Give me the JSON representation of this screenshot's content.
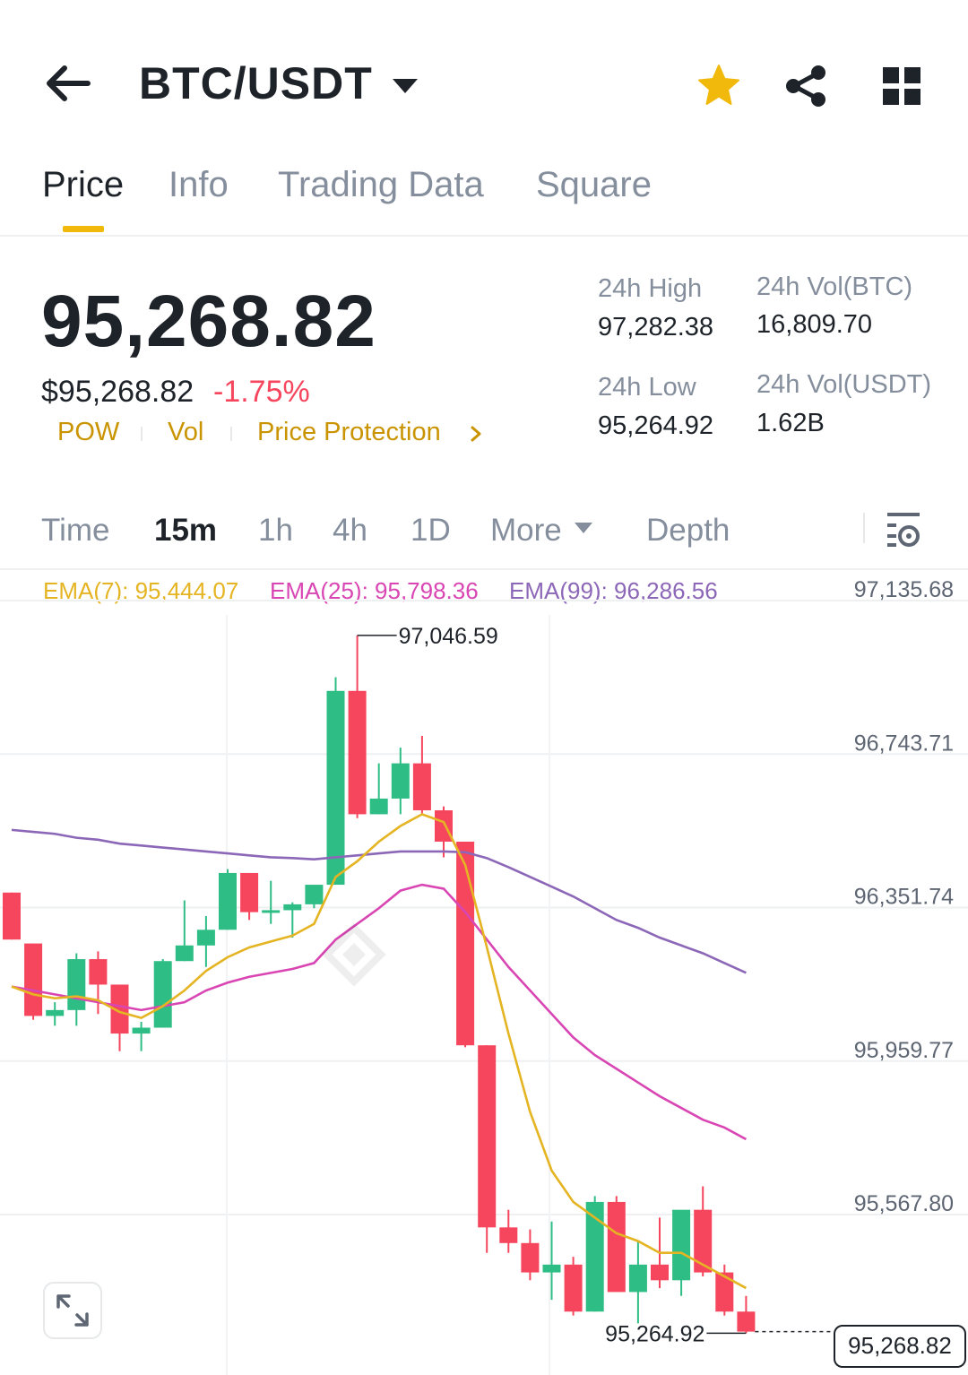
{
  "header": {
    "pair": "BTC/USDT",
    "icons": {
      "back": "back-arrow-icon",
      "caret": "caret-down-icon",
      "favorite": "star-icon",
      "share": "share-icon",
      "layout": "grid-icon"
    },
    "favorite_color": "#f0b90b"
  },
  "tabs": [
    {
      "label": "Price",
      "active": true
    },
    {
      "label": "Info",
      "active": false
    },
    {
      "label": "Trading Data",
      "active": false
    },
    {
      "label": "Square",
      "active": false
    }
  ],
  "price": {
    "last": "95,268.82",
    "fiat": "$95,268.82",
    "change": "-1.75%",
    "change_color": "#f6465d",
    "tags": [
      "POW",
      "Vol",
      "Price Protection"
    ]
  },
  "stats": {
    "high_label": "24h High",
    "high_value": "97,282.38",
    "low_label": "24h Low",
    "low_value": "95,264.92",
    "vol_btc_label": "24h Vol(BTC)",
    "vol_btc_value": "16,809.70",
    "vol_usdt_label": "24h Vol(USDT)",
    "vol_usdt_value": "1.62B"
  },
  "intervals": [
    {
      "label": "Time",
      "active": false
    },
    {
      "label": "15m",
      "active": true
    },
    {
      "label": "1h",
      "active": false
    },
    {
      "label": "4h",
      "active": false
    },
    {
      "label": "1D",
      "active": false
    },
    {
      "label": "More",
      "active": false
    },
    {
      "label": "Depth",
      "active": false
    }
  ],
  "ema": {
    "ema7": "EMA(7): 95,444.07",
    "ema25": "EMA(25): 95,798.36",
    "ema99": "EMA(99): 96,286.56",
    "ema7_color": "#e5b422",
    "ema25_color": "#d946b4",
    "ema99_color": "#8c67b8"
  },
  "chart_data": {
    "type": "candlestick",
    "up_color": "#2ebd85",
    "down_color": "#f6465d",
    "y_ticks": [
      "97,135.68",
      "96,743.71",
      "96,351.74",
      "95,959.77",
      "95,567.80"
    ],
    "ylim": [
      95150,
      97250
    ],
    "high_marker": "97,046.59",
    "low_marker": "95,264.92",
    "last_price": "95,268.82",
    "candles": [
      {
        "o": 96390,
        "h": 96390,
        "l": 96270,
        "c": 96270
      },
      {
        "o": 96260,
        "h": 96260,
        "l": 96065,
        "c": 96075
      },
      {
        "o": 96075,
        "h": 96110,
        "l": 96050,
        "c": 96090
      },
      {
        "o": 96090,
        "h": 96235,
        "l": 96050,
        "c": 96220
      },
      {
        "o": 96220,
        "h": 96240,
        "l": 96080,
        "c": 96155
      },
      {
        "o": 96155,
        "h": 96155,
        "l": 95985,
        "c": 96030
      },
      {
        "o": 96030,
        "h": 96060,
        "l": 95985,
        "c": 96045
      },
      {
        "o": 96045,
        "h": 96220,
        "l": 96045,
        "c": 96215
      },
      {
        "o": 96215,
        "h": 96370,
        "l": 96215,
        "c": 96255
      },
      {
        "o": 96255,
        "h": 96330,
        "l": 96200,
        "c": 96295
      },
      {
        "o": 96295,
        "h": 96450,
        "l": 96295,
        "c": 96440
      },
      {
        "o": 96440,
        "h": 96440,
        "l": 96320,
        "c": 96340
      },
      {
        "o": 96340,
        "h": 96420,
        "l": 96310,
        "c": 96345
      },
      {
        "o": 96345,
        "h": 96365,
        "l": 96275,
        "c": 96360
      },
      {
        "o": 96360,
        "h": 96365,
        "l": 96350,
        "c": 96410
      },
      {
        "o": 96410,
        "h": 96940,
        "l": 96410,
        "c": 96905
      },
      {
        "o": 96905,
        "h": 97046.59,
        "l": 96580,
        "c": 96590
      },
      {
        "o": 96590,
        "h": 96720,
        "l": 96590,
        "c": 96630
      },
      {
        "o": 96630,
        "h": 96760,
        "l": 96590,
        "c": 96720
      },
      {
        "o": 96720,
        "h": 96790,
        "l": 96590,
        "c": 96600
      },
      {
        "o": 96600,
        "h": 96610,
        "l": 96480,
        "c": 96520
      },
      {
        "o": 96520,
        "h": 96520,
        "l": 95995,
        "c": 96000
      },
      {
        "o": 96000,
        "h": 96000,
        "l": 95470,
        "c": 95535
      },
      {
        "o": 95535,
        "h": 95580,
        "l": 95470,
        "c": 95495
      },
      {
        "o": 95495,
        "h": 95530,
        "l": 95400,
        "c": 95420
      },
      {
        "o": 95420,
        "h": 95550,
        "l": 95350,
        "c": 95440
      },
      {
        "o": 95440,
        "h": 95460,
        "l": 95310,
        "c": 95320
      },
      {
        "o": 95320,
        "h": 95615,
        "l": 95320,
        "c": 95600
      },
      {
        "o": 95600,
        "h": 95615,
        "l": 95370,
        "c": 95370
      },
      {
        "o": 95370,
        "h": 95500,
        "l": 95290,
        "c": 95440
      },
      {
        "o": 95440,
        "h": 95560,
        "l": 95380,
        "c": 95400
      },
      {
        "o": 95400,
        "h": 95575,
        "l": 95360,
        "c": 95580
      },
      {
        "o": 95580,
        "h": 95640,
        "l": 95410,
        "c": 95420
      },
      {
        "o": 95420,
        "h": 95440,
        "l": 95310,
        "c": 95320
      },
      {
        "o": 95320,
        "h": 95360,
        "l": 95264.92,
        "c": 95268.82
      }
    ],
    "ema7_series": [
      96150,
      96130,
      96120,
      96125,
      96115,
      96085,
      96070,
      96100,
      96140,
      96190,
      96225,
      96250,
      96265,
      96280,
      96310,
      96430,
      96470,
      96520,
      96560,
      96590,
      96570,
      96460,
      96250,
      96030,
      95830,
      95680,
      95600,
      95560,
      95520,
      95500,
      95470,
      95470,
      95440,
      95410,
      95380
    ],
    "ema25_series": [
      96150,
      96140,
      96130,
      96120,
      96110,
      96100,
      96090,
      96100,
      96110,
      96140,
      96160,
      96175,
      96185,
      96195,
      96210,
      96270,
      96310,
      96350,
      96395,
      96410,
      96400,
      96340,
      96270,
      96200,
      96140,
      96080,
      96020,
      95975,
      95940,
      95905,
      95870,
      95840,
      95810,
      95790,
      95760
    ],
    "ema99_series": [
      96550,
      96545,
      96540,
      96530,
      96525,
      96515,
      96510,
      96505,
      96500,
      96495,
      96490,
      96485,
      96480,
      96478,
      96475,
      96480,
      96485,
      96490,
      96495,
      96495,
      96495,
      96493,
      96478,
      96455,
      96430,
      96405,
      96380,
      96350,
      96320,
      96300,
      96275,
      96255,
      96235,
      96210,
      96185
    ]
  }
}
